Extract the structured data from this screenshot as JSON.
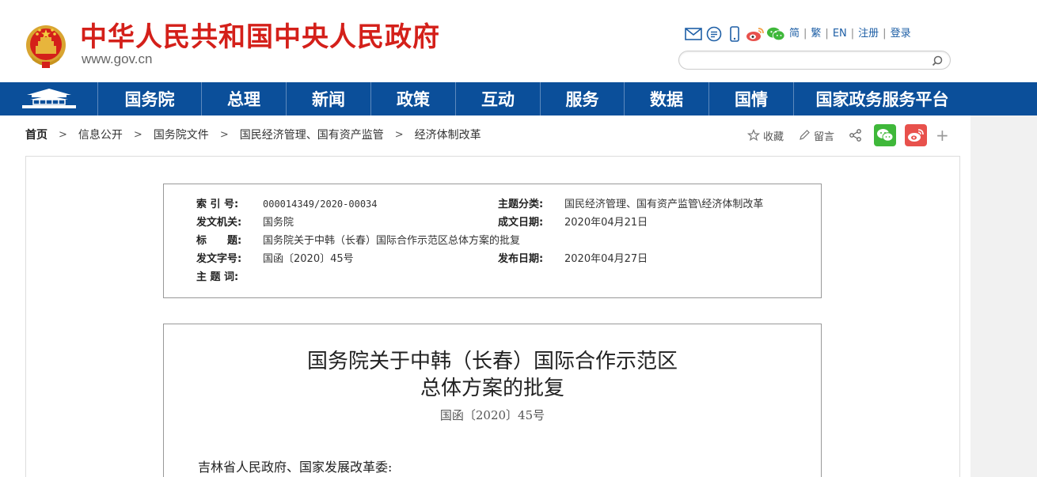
{
  "header": {
    "site_title": "中华人民共和国中央人民政府",
    "site_url": "www.gov.cn",
    "tools": {
      "icons": [
        "mail-icon",
        "message-icon",
        "mobile-icon",
        "weibo-icon",
        "wechat-icon"
      ],
      "lang": [
        "简",
        "繁",
        "EN",
        "注册",
        "登录"
      ],
      "separator": "|"
    },
    "search": {
      "placeholder": ""
    }
  },
  "nav": {
    "items": [
      "国务院",
      "总理",
      "新闻",
      "政策",
      "互动",
      "服务",
      "数据",
      "国情",
      "国家政务服务平台"
    ]
  },
  "breadcrumb": {
    "items": [
      "首页",
      "信息公开",
      "国务院文件",
      "国民经济管理、国有资产监管",
      "经济体制改革"
    ],
    "separator": ">"
  },
  "share": {
    "favorite": "收藏",
    "comment": "留言",
    "plus": "+"
  },
  "meta": {
    "index_label": "索 引 号:",
    "index_value": "000014349/2020-00034",
    "topic_label": "主题分类:",
    "topic_value": "国民经济管理、国有资产监管\\经济体制改革",
    "issuer_label": "发文机关:",
    "issuer_value": "国务院",
    "written_label": "成文日期:",
    "written_value": "2020年04月21日",
    "title_label": "标　　题:",
    "title_value": "国务院关于中韩（长春）国际合作示范区总体方案的批复",
    "docno_label": "发文字号:",
    "docno_value": "国函〔2020〕45号",
    "published_label": "发布日期:",
    "published_value": "2020年04月27日",
    "keywords_label": "主 题 词:",
    "keywords_value": ""
  },
  "document": {
    "title_line1": "国务院关于中韩（长春）国际合作示范区",
    "title_line2": "总体方案的批复",
    "doc_number": "国函〔2020〕45号",
    "addressee": "吉林省人民政府、国家发展改革委:"
  },
  "colors": {
    "brand_red": "#d4201a",
    "nav_blue": "#0b4f9a",
    "link_blue": "#1e5fa6",
    "wechat_green": "#3fb83a",
    "weibo_red": "#e8514c"
  }
}
